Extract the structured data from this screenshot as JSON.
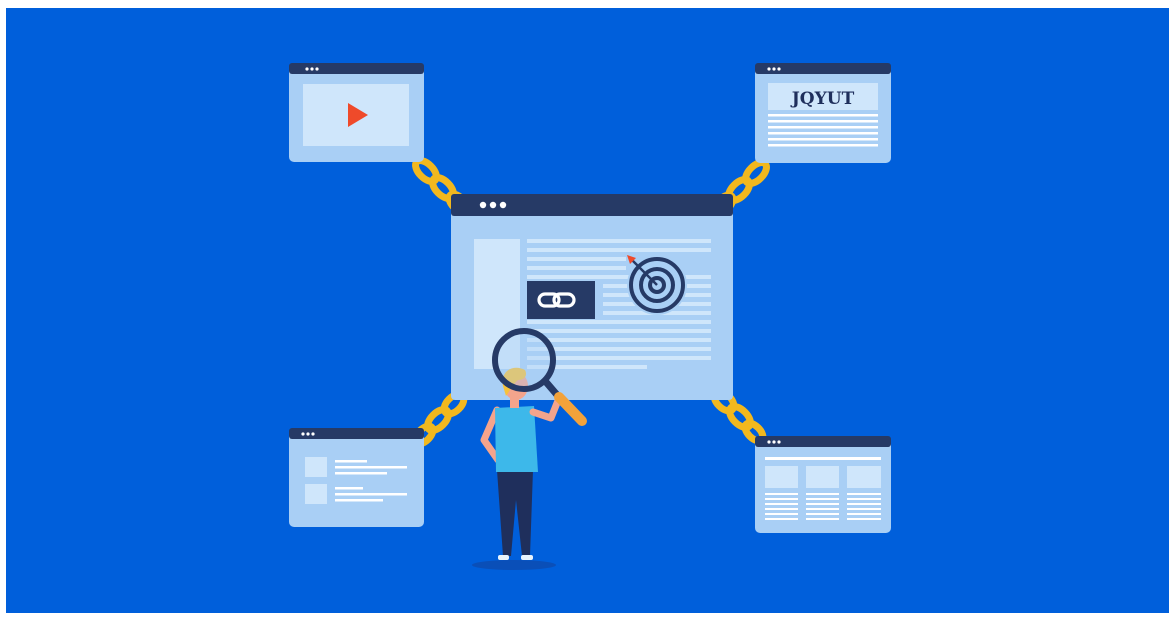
{
  "scene": {
    "background_color": "#005fdb",
    "frame_color": "#ffffff",
    "window_body_color": "#a9cff5",
    "window_bar_color": "#263a66",
    "chain_color": "#f2b81e",
    "accent_red": "#ef4a2a"
  },
  "windows": {
    "top_left": {
      "content_icon": "play-icon"
    },
    "top_right": {
      "label": "JQYUT"
    },
    "bottom_left": {
      "content": "list-with-thumbnails"
    },
    "bottom_right": {
      "content": "three-column-table"
    },
    "center": {
      "content": [
        "sidebar",
        "text-lines",
        "link-icon",
        "target-icon"
      ]
    }
  },
  "figure": {
    "shirt_color": "#3db8ea",
    "pants_color": "#1f2f5c",
    "hair_color": "#f7c23a",
    "held_tool": "magnifying-glass-icon"
  }
}
